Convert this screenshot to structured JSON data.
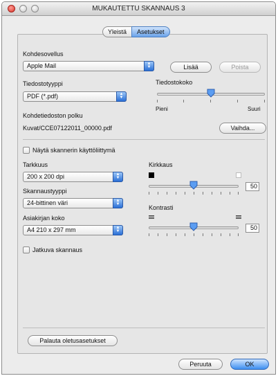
{
  "window": {
    "title": "MUKAUTETTU SKANNAUS 3"
  },
  "tabs": [
    {
      "label": "Yleistä",
      "active": false
    },
    {
      "label": "Asetukset",
      "active": true
    }
  ],
  "target_app": {
    "label": "Kohdesovellus",
    "value": "Apple Mail",
    "add_button": "Lisää",
    "remove_button": "Poista"
  },
  "file_type": {
    "label": "Tiedostotyyppi",
    "value": "PDF (*.pdf)"
  },
  "file_size": {
    "label": "Tiedostokoko",
    "min_label": "Pieni",
    "max_label": "Suuri",
    "level": 0.5
  },
  "file_path": {
    "label": "Kohdetiedoston polku",
    "value": "Kuvat/CCE07122011_00000.pdf",
    "change_button": "Vaihda..."
  },
  "show_interface": {
    "label": "Näytä skannerin käyttöliittymä",
    "checked": false
  },
  "resolution": {
    "label": "Tarkkuus",
    "value": "200 x 200 dpi"
  },
  "scan_type": {
    "label": "Skannaustyyppi",
    "value": "24-bittinen väri"
  },
  "document_size": {
    "label": "Asiakirjan koko",
    "value": "A4 210 x 297 mm"
  },
  "continuous_scan": {
    "label": "Jatkuva skannaus",
    "checked": false
  },
  "brightness": {
    "label": "Kirkkaus",
    "value": "50"
  },
  "contrast": {
    "label": "Kontrasti",
    "value": "50"
  },
  "footer": {
    "restore_defaults": "Palauta oletusasetukset",
    "cancel": "Peruuta",
    "ok": "OK"
  },
  "colors": {
    "accent": "#3d8ef0",
    "close_button": "#d9342b"
  }
}
